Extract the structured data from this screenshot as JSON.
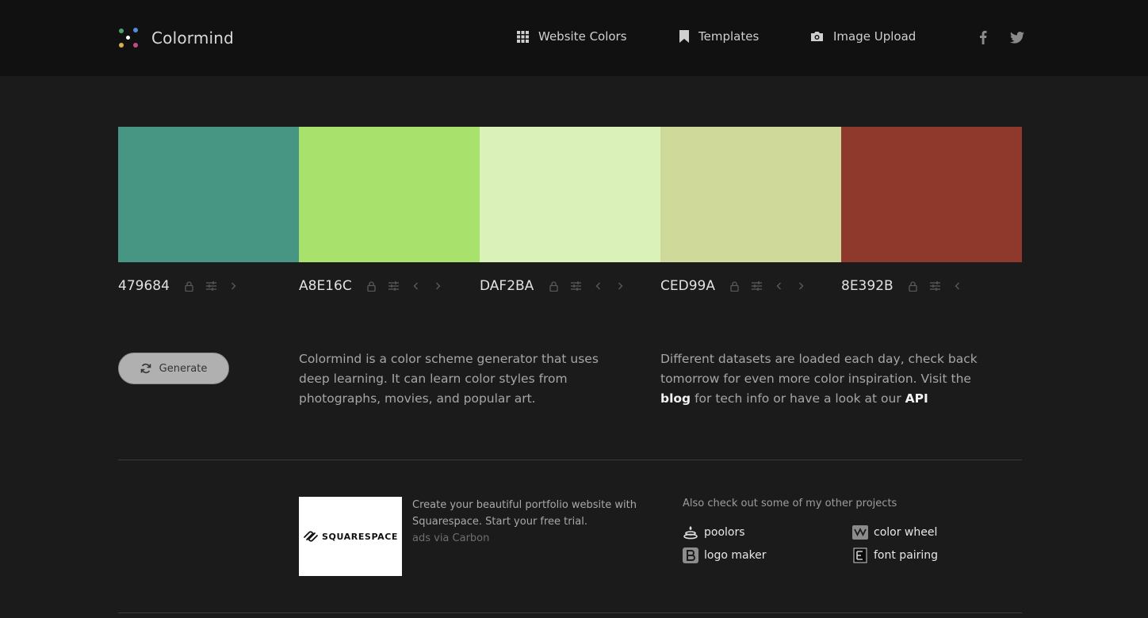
{
  "header": {
    "brand": "Colormind",
    "nav": [
      {
        "label": "Website Colors",
        "icon": "grid-icon"
      },
      {
        "label": "Templates",
        "icon": "bookmark-icon"
      },
      {
        "label": "Image Upload",
        "icon": "camera-icon"
      }
    ],
    "social": [
      "facebook-icon",
      "twitter-icon"
    ]
  },
  "palette": [
    {
      "hex": "479684",
      "color": "#479684"
    },
    {
      "hex": "A8E16C",
      "color": "#A8E16C"
    },
    {
      "hex": "DAF2BA",
      "color": "#DAF2BA"
    },
    {
      "hex": "CED99A",
      "color": "#CED99A"
    },
    {
      "hex": "8E392B",
      "color": "#8E392B"
    }
  ],
  "generate": {
    "label": "Generate"
  },
  "about": {
    "text": "Colormind is a color scheme generator that uses deep learning. It can learn color styles from photographs, movies, and popular art."
  },
  "datasets": {
    "text_before": "Different datasets are loaded each day, check back tomorrow for even more color inspiration. Visit the ",
    "blog_link": "blog",
    "text_middle": " for tech info or have a look at our ",
    "api_link": "API"
  },
  "ad": {
    "logo_text": "SQUARESPACE",
    "text": "Create your beautiful portfolio website with Squarespace. Start your free trial.",
    "via": "ads via Carbon"
  },
  "projects": {
    "title": "Also check out some of my other projects",
    "items": [
      {
        "label": "poolors",
        "icon": "poolors-icon"
      },
      {
        "label": "color wheel",
        "icon": "color-wheel-icon"
      },
      {
        "label": "logo maker",
        "icon": "logo-maker-icon"
      },
      {
        "label": "font pairing",
        "icon": "font-pairing-icon"
      }
    ]
  }
}
